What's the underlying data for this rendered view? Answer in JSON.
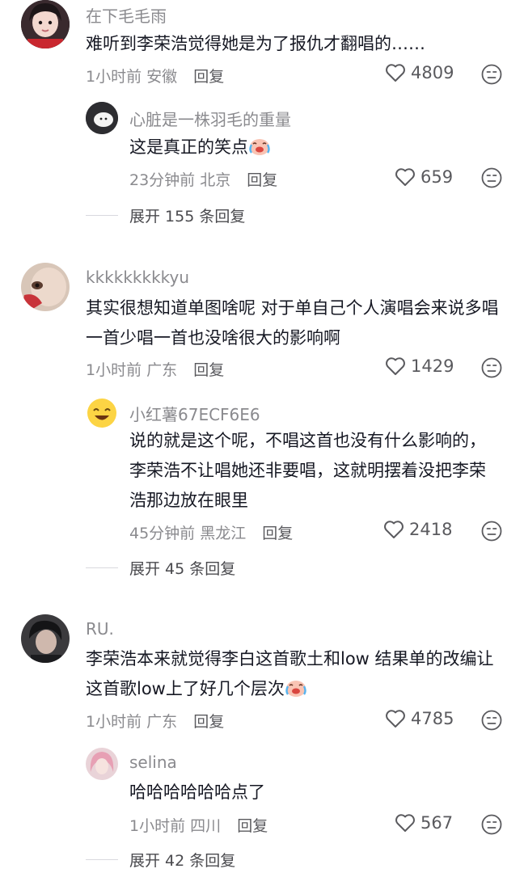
{
  "comments": [
    {
      "username": "在下毛毛雨",
      "text": "难听到李荣浩觉得她是为了报仇才翻唱的……",
      "time": "1小时前",
      "location": "安徽",
      "reply_label": "回复",
      "likes": "4809",
      "reply": {
        "username": "心脏是一株羽毛的重量",
        "text": "这是真正的笑点",
        "emoji": "laugh-cry-emoji",
        "time": "23分钟前",
        "location": "北京",
        "reply_label": "回复",
        "likes": "659"
      },
      "expand_label": "展开 155 条回复"
    },
    {
      "username": "kkkkkkkkkyu",
      "text": "其实很想知道单图啥呢 对于单自己个人演唱会来说多唱一首少唱一首也没啥很大的影响啊",
      "time": "1小时前",
      "location": "广东",
      "reply_label": "回复",
      "likes": "1429",
      "reply": {
        "username": "小红薯67ECF6E6",
        "text": "说的就是这个呢，不唱这首也没有什么影响的，李荣浩不让唱她还非要唱，这就明摆着没把李荣浩那边放在眼里",
        "time": "45分钟前",
        "location": "黑龙江",
        "reply_label": "回复",
        "likes": "2418"
      },
      "expand_label": "展开 45 条回复"
    },
    {
      "username": "RU.",
      "text": "李荣浩本来就觉得李白这首歌土和low  结果单的改编让这首歌low上了好几个层次",
      "emoji": "laugh-cry-emoji",
      "time": "1小时前",
      "location": "广东",
      "reply_label": "回复",
      "likes": "4785",
      "reply": {
        "username": "selina",
        "text": "哈哈哈哈哈哈点了",
        "time": "1小时前",
        "location": "四川",
        "reply_label": "回复",
        "likes": "567"
      },
      "expand_label": "展开 42 条回复"
    }
  ]
}
